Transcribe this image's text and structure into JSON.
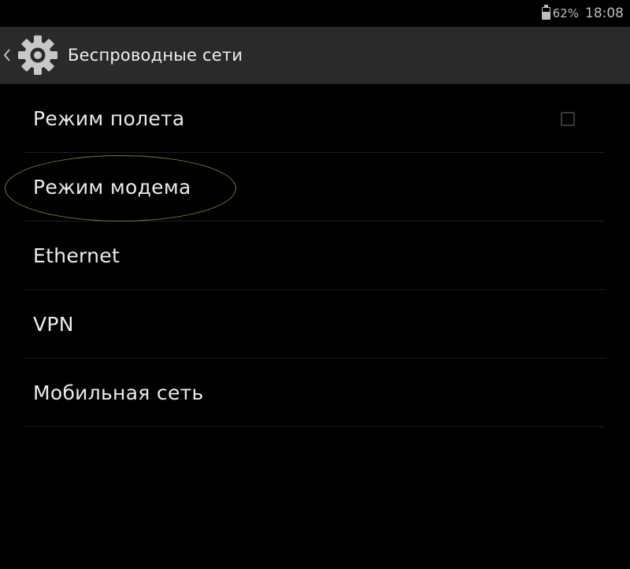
{
  "status_bar": {
    "battery_percent": "62%",
    "battery_level": 0.62,
    "time": "18:08"
  },
  "action_bar": {
    "title": "Беспроводные сети",
    "icon": "settings-gear-icon",
    "up_icon": "chevron-left-icon"
  },
  "items": [
    {
      "label": "Режим полета",
      "has_checkbox": true,
      "checked": false
    },
    {
      "label": "Режим модема"
    },
    {
      "label": "Ethernet"
    },
    {
      "label": "VPN"
    },
    {
      "label": "Мобильная сеть"
    }
  ],
  "colors": {
    "background": "#000000",
    "action_bar": "#2a2a2a",
    "text": "#ececec",
    "status_text": "#bdbdbd",
    "highlight": "#6f7a3a"
  }
}
